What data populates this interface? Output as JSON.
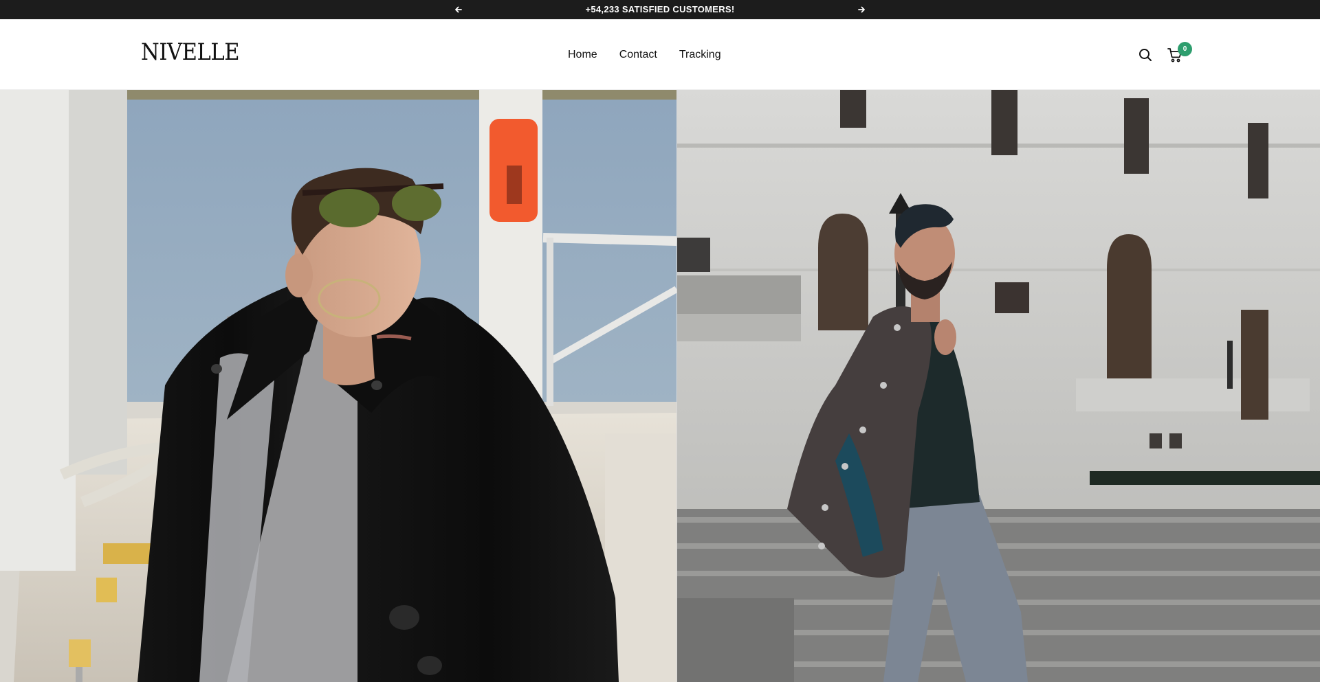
{
  "announcement": {
    "message": "+54,233 SATISFIED CUSTOMERS!",
    "prev_icon": "arrow-left-icon",
    "next_icon": "arrow-right-icon"
  },
  "header": {
    "logo": "NIVELLE",
    "nav": [
      {
        "label": "Home"
      },
      {
        "label": "Contact"
      },
      {
        "label": "Tracking"
      }
    ],
    "search_icon": "search-icon",
    "cart_icon": "cart-icon",
    "cart_count": "0"
  },
  "hero": {
    "left_image": "man-in-black-coat-and-sunglasses-on-pier",
    "right_image": "man-with-coat-over-shoulder-on-stone-steps"
  },
  "colors": {
    "announcement_bg": "#1c1c1c",
    "accent": "#2e9e6e",
    "text": "#111111"
  }
}
